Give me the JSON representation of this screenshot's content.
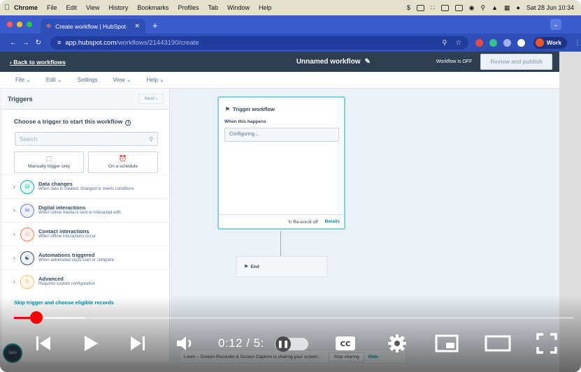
{
  "macos": {
    "menu": [
      "Chrome",
      "File",
      "Edit",
      "View",
      "History",
      "Bookmarks",
      "Profiles",
      "Tab",
      "Window",
      "Help"
    ],
    "clock": "Sat 28 Jun 10:34"
  },
  "browser": {
    "tab_title": "Create workflow | HubSpot",
    "url_host": "app.hubspot.com",
    "url_path": "/workflows/21443190/create",
    "profile": "Work"
  },
  "hubspot": {
    "back_link": "Back to workflows",
    "workflow_title": "Unnamed workflow",
    "workflow_status": "Workflow is OFF",
    "review_button": "Review and publish",
    "menu": [
      "File",
      "Edit",
      "Settings",
      "View",
      "Help"
    ]
  },
  "panel": {
    "title": "Triggers",
    "next_button": "Next",
    "heading": "Choose a trigger to start this workflow",
    "search_placeholder": "Search",
    "cards": [
      "Manually trigger only",
      "On a schedule"
    ],
    "categories": [
      {
        "title": "Data changes",
        "desc": "When data is created, changed or meets conditions",
        "color": "#00bda5",
        "bg": "#e5f8f6",
        "icon": "database-icon"
      },
      {
        "title": "Digital interactions",
        "desc": "When online media is sent or interacted with",
        "color": "#6a78d1",
        "bg": "#eef0fb",
        "icon": "email-icon"
      },
      {
        "title": "Contact interactions",
        "desc": "When offline interactions occur",
        "color": "#ff7a59",
        "bg": "#fff1ee",
        "icon": "people-icon"
      },
      {
        "title": "Automations triggered",
        "desc": "When automated steps start or complete",
        "color": "#33475b",
        "bg": "#f5f8fa",
        "icon": "workflow-icon"
      },
      {
        "title": "Advanced",
        "desc": "Requires custom configuration",
        "color": "#f5c26b",
        "bg": "#fef8f0",
        "icon": "function-icon"
      }
    ],
    "skip_link": "Skip trigger and choose eligible records"
  },
  "canvas": {
    "trigger_title": "Trigger workflow",
    "when_label": "When this happens",
    "configuring": "Configuring...",
    "reenroll": "Re-enroll off",
    "details": "Details",
    "end_label": "End"
  },
  "loom": {
    "message": "Loom – Screen Recorder & Screen Capture is sharing your screen.",
    "stop": "Stop sharing",
    "hide": "Hide"
  },
  "help_badge": "Sets",
  "player": {
    "time_display": "0:12 / 5:",
    "played_fraction": 0.04,
    "buffered_fraction": 0.127
  }
}
